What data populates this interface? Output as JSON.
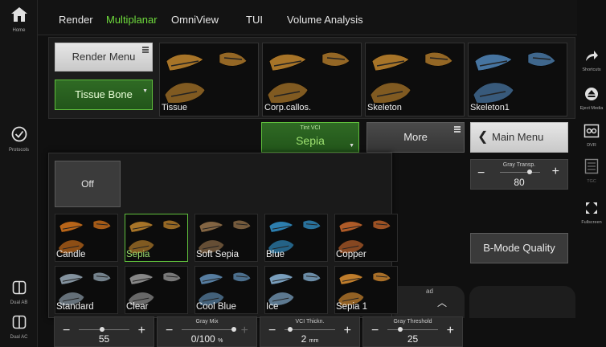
{
  "left_rail": {
    "home": {
      "label": "Home",
      "icon": "home-icon"
    },
    "protocols": {
      "label": "Protocols",
      "icon": "check-circle-icon"
    },
    "dual_ab": {
      "label": "Dual AB",
      "icon": "dual-screen-icon"
    },
    "dual_ac": {
      "label": "Dual AC",
      "icon": "dual-screen-icon"
    }
  },
  "tabs": [
    {
      "label": "Render",
      "active": false
    },
    {
      "label": "Multiplanar",
      "active": true
    },
    {
      "label": "OmniView",
      "active": false
    },
    {
      "label": "TUI",
      "active": false
    },
    {
      "label": "Volume Analysis",
      "active": false
    }
  ],
  "render_menu": {
    "label": "Render Menu"
  },
  "tissue_bone": {
    "label": "Tissue Bone"
  },
  "presets": [
    {
      "label": "Tissue",
      "color": "#b07a2a"
    },
    {
      "label": "Corp.callos.",
      "color": "#b07a2a"
    },
    {
      "label": "Skeleton",
      "color": "#b07a2a"
    },
    {
      "label": "Skeleton1",
      "color": "#4a7aa8"
    }
  ],
  "tint_vci": {
    "title": "Tint VCI",
    "value": "Sepia"
  },
  "more": {
    "label": "More"
  },
  "main_menu": {
    "label": "Main Menu"
  },
  "gray_transp": {
    "title": "Gray Transp.",
    "value": "80"
  },
  "b_mode_quality": {
    "label": "B-Mode Quality"
  },
  "popup": {
    "off_label": "Off",
    "tints": [
      {
        "label": "Candle",
        "color": "#c26a1a",
        "selected": false
      },
      {
        "label": "Sepia",
        "color": "#b07a2a",
        "selected": true
      },
      {
        "label": "Soft Sepia",
        "color": "#8a6a46",
        "selected": false
      },
      {
        "label": "Blue",
        "color": "#2f86b8",
        "selected": false
      },
      {
        "label": "Copper",
        "color": "#b8602a",
        "selected": false
      },
      {
        "label": "Standard",
        "color": "#8a9aa6",
        "selected": false
      },
      {
        "label": "Clear",
        "color": "#8e8e8e",
        "selected": false
      },
      {
        "label": "Cool Blue",
        "color": "#5a84a8",
        "selected": false
      },
      {
        "label": "Ice",
        "color": "#7fa6c6",
        "selected": false
      },
      {
        "label": "Sepia 1",
        "color": "#c9842e",
        "selected": false
      }
    ]
  },
  "partial_label": "ad",
  "right_rail": {
    "shortcuts": {
      "label": "Shortcuts",
      "icon": "arrow-icon"
    },
    "eject": {
      "label": "Eject Media",
      "icon": "eject-icon"
    },
    "dvr": {
      "label": "DVR",
      "icon": "dvr-icon"
    },
    "tgc": {
      "label": "TGC",
      "icon": "tgc-icon"
    },
    "fullscreen": {
      "label": "Fullscreen",
      "icon": "fullscreen-icon"
    }
  },
  "sliders": [
    {
      "title": "",
      "value": "55",
      "level": 0.45
    },
    {
      "title": "Gray Mix",
      "value": "0/100",
      "unit": "%",
      "level": 1.0
    },
    {
      "title": "VCI Thickn.",
      "value": "2",
      "unit": "mm",
      "level": 0.1
    },
    {
      "title": "Gray Threshold",
      "value": "25",
      "level": 0.25
    }
  ],
  "colors": {
    "accent_green": "#6fdc3c"
  }
}
